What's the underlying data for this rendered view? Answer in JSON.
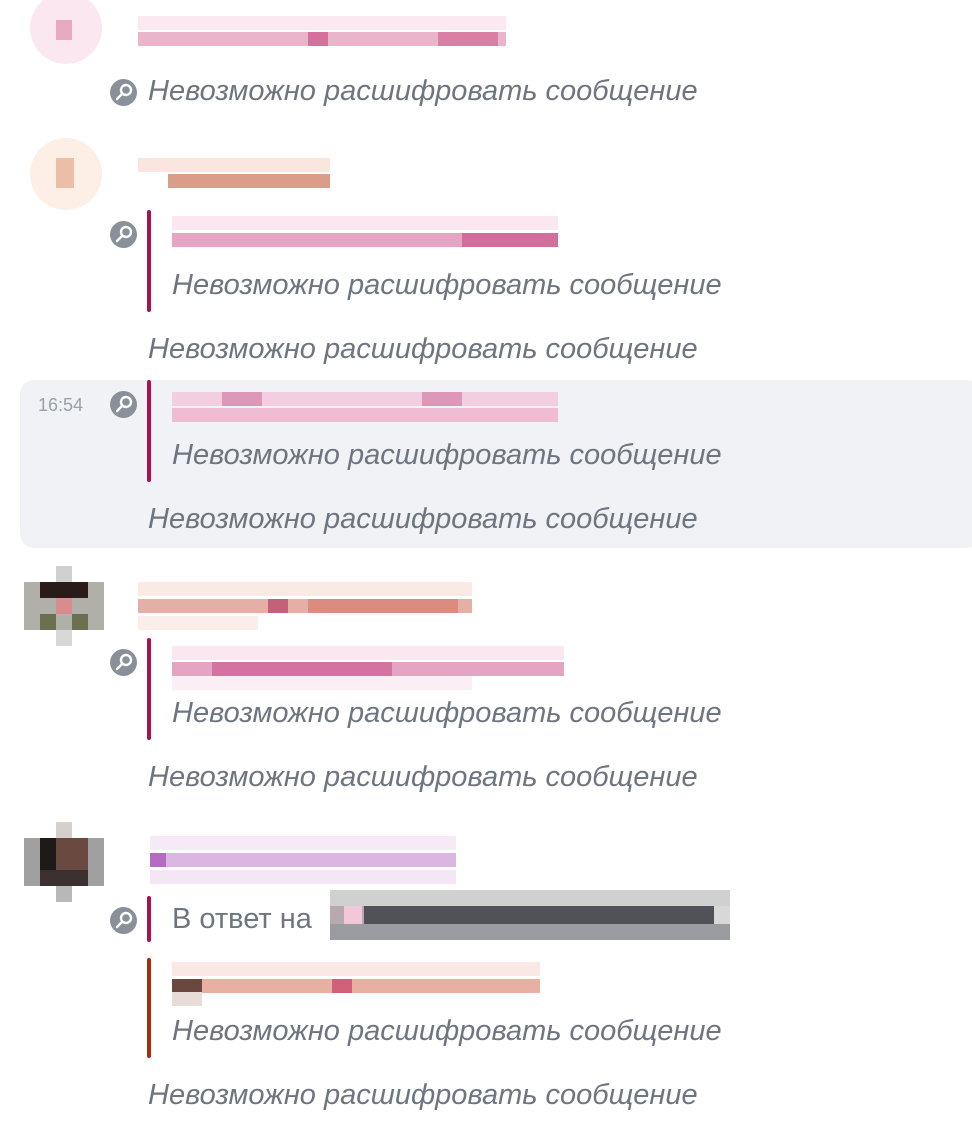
{
  "colors": {
    "quote_bar": "#a8134f",
    "quote_bar_reply": "#a82a10",
    "muted_text": "#6f7580",
    "hover_bg": "#f1f2f5"
  },
  "messages": {
    "undecryptable": "Невозможно расшифровать сообщение",
    "reply_prefix": "В ответ на",
    "timestamp": "16:54"
  },
  "icons": {
    "key": "key-icon"
  }
}
